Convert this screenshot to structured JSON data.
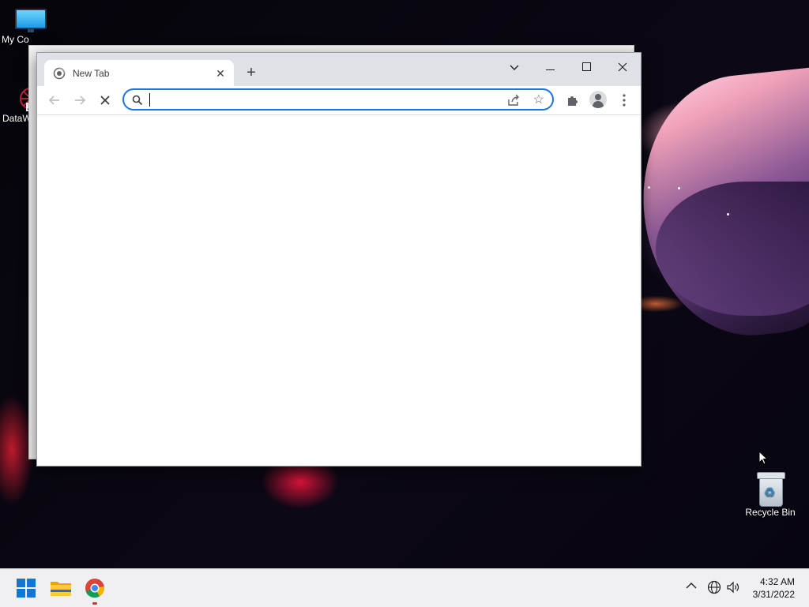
{
  "desktop": {
    "icons": [
      {
        "label": "My Co",
        "icon": "monitor-icon"
      },
      {
        "label": "DataW",
        "icon": "app-shortcut-icon"
      },
      {
        "label": "Recycle Bin",
        "icon": "recycle-bin-icon"
      }
    ]
  },
  "browser": {
    "tab": {
      "title": "New Tab",
      "favicon": "loading-globe-icon"
    },
    "omnibox": {
      "value": "",
      "placeholder": ""
    },
    "accent_color": "#1a73e8"
  },
  "taskbar": {
    "apps": [
      "start-icon",
      "file-explorer-icon",
      "chrome-icon"
    ],
    "clock": {
      "time": "4:32 AM",
      "date": "3/31/2022"
    }
  }
}
